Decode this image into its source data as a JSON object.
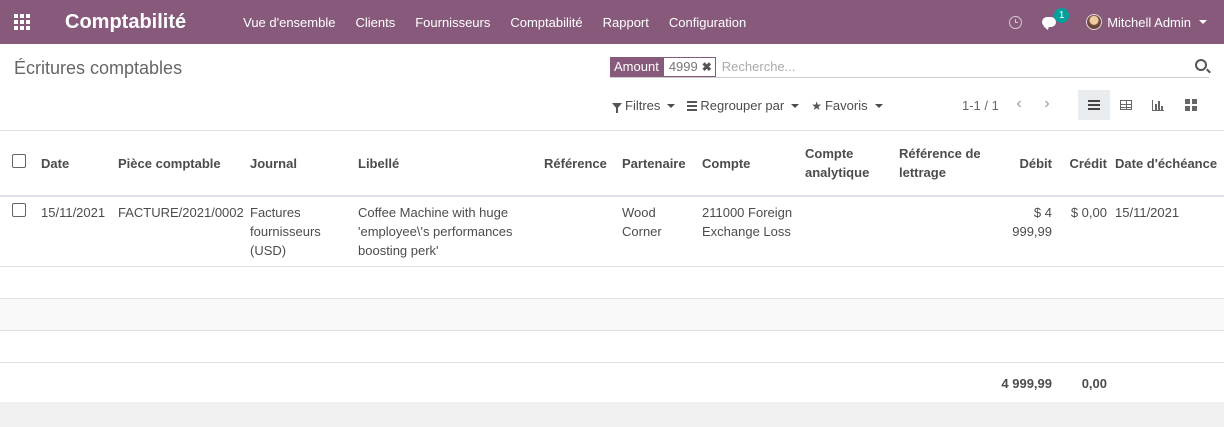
{
  "navbar": {
    "app_title": "Comptabilité",
    "menu": [
      "Vue d'ensemble",
      "Clients",
      "Fournisseurs",
      "Comptabilité",
      "Rapport",
      "Configuration"
    ],
    "messages_count": "1",
    "user_name": "Mitchell Admin",
    "color": "#875a7b"
  },
  "control_panel": {
    "breadcrumb": "Écritures comptables",
    "search": {
      "facet_label": "Amount",
      "facet_value": "4999",
      "placeholder": "Recherche..."
    },
    "filters_label": "Filtres",
    "group_by_label": "Regrouper par",
    "favorites_label": "Favoris",
    "pager": "1-1 / 1",
    "views": [
      "list-icon",
      "pivot-icon",
      "graph-icon",
      "kanban-icon"
    ],
    "active_view": "list"
  },
  "table": {
    "columns": {
      "date": "Date",
      "piece": "Pièce comptable",
      "journal": "Journal",
      "libelle": "Libellé",
      "reference": "Référence",
      "partenaire": "Partenaire",
      "compte": "Compte",
      "compte_analytique": "Compte analytique",
      "ref_lettrage": "Référence de lettrage",
      "debit": "Débit",
      "credit": "Crédit",
      "echeance": "Date d'échéance"
    },
    "rows": [
      {
        "date": "15/11/2021",
        "piece": "FACTURE/2021/0002",
        "journal": "Factures fournisseurs (USD)",
        "libelle": "Coffee Machine with huge 'employee\\'s performances boosting perk'",
        "reference": "",
        "partenaire": "Wood Corner",
        "compte": "211000 Foreign Exchange Loss",
        "compte_analytique": "",
        "ref_lettrage": "",
        "debit": "$ 4 999,99",
        "credit": "$ 0,00",
        "echeance": "15/11/2021"
      }
    ],
    "totals": {
      "debit": "4 999,99",
      "credit": "0,00"
    }
  }
}
